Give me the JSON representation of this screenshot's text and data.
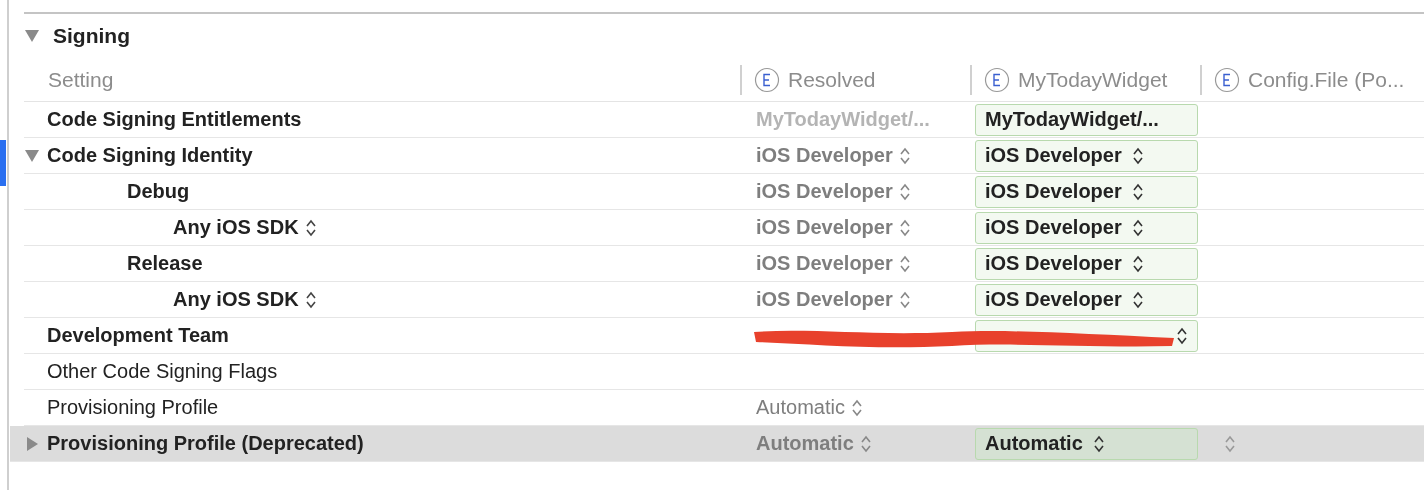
{
  "section": {
    "title": "Signing",
    "expanded": true
  },
  "columns": [
    {
      "kind": "setting",
      "label": "Setting"
    },
    {
      "kind": "level",
      "label": "Resolved"
    },
    {
      "kind": "level",
      "label": "MyTodayWidget"
    },
    {
      "kind": "level",
      "label": "Config.File (Po..."
    }
  ],
  "rows": [
    {
      "label": "Code Signing Entitlements",
      "bold": true,
      "selected": false,
      "resolved": {
        "text": "MyTodayWidget/...",
        "kind": "faded"
      },
      "target": {
        "text": "MyTodayWidget/..."
      }
    },
    {
      "label": "Code Signing Identity",
      "bold": true,
      "selected": false,
      "expanded": true,
      "resolved": {
        "text": "iOS Developer",
        "kind": "bold",
        "popup": true
      },
      "target": {
        "text": "iOS Developer",
        "popup": true
      },
      "children": [
        {
          "label": "Debug",
          "bold": true,
          "selected": false,
          "resolved": {
            "text": "iOS Developer",
            "kind": "bold",
            "popup": true
          },
          "target": {
            "text": "iOS Developer",
            "popup": true
          },
          "children": [
            {
              "label": "Any iOS SDK",
              "bold": true,
              "popup": true,
              "selected": false,
              "resolved": {
                "text": "iOS Developer",
                "kind": "bold",
                "popup": true
              },
              "target": {
                "text": "iOS Developer",
                "popup": true
              }
            }
          ]
        },
        {
          "label": "Release",
          "bold": true,
          "selected": false,
          "resolved": {
            "text": "iOS Developer",
            "kind": "bold",
            "popup": true
          },
          "target": {
            "text": "iOS Developer",
            "popup": true
          },
          "children": [
            {
              "label": "Any iOS SDK",
              "bold": true,
              "popup": true,
              "selected": false,
              "resolved": {
                "text": "iOS Developer",
                "kind": "bold",
                "popup": true
              },
              "target": {
                "text": "iOS Developer",
                "popup": true
              }
            }
          ]
        }
      ]
    },
    {
      "label": "Development Team",
      "bold": true,
      "selected": false,
      "redacted": true,
      "target": {
        "popup": true
      }
    },
    {
      "label": "Other Code Signing Flags",
      "bold": false,
      "selected": false
    },
    {
      "label": "Provisioning Profile",
      "bold": false,
      "selected": false,
      "resolved": {
        "text": "Automatic",
        "kind": "regular",
        "popup": true
      }
    },
    {
      "label": "Provisioning Profile (Deprecated)",
      "bold": true,
      "selected": true,
      "expanded": false,
      "resolved": {
        "text": "Automatic",
        "kind": "bold",
        "popup": true
      },
      "target": {
        "text": "Automatic",
        "popup": true
      },
      "config": {
        "popup": true
      }
    }
  ]
}
